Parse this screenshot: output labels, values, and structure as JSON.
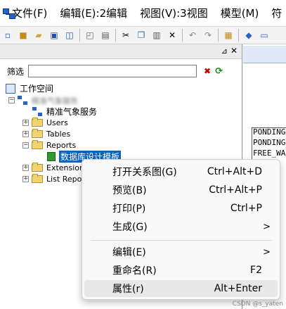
{
  "menubar": {
    "items": [
      "文件(F)",
      "编辑(E):2编辑",
      "视图(V):3视图",
      "模型(M)",
      "符"
    ]
  },
  "toolbar": {
    "icons": [
      "new-icon",
      "open-model-icon",
      "open-folder-icon",
      "save-icon",
      "save-all-icon",
      "print-preview-icon",
      "print-icon",
      "cut-icon",
      "copy-icon",
      "paste-icon",
      "delete-icon",
      "undo-icon",
      "redo-icon",
      "properties-icon",
      "help-icon",
      "window-icon"
    ]
  },
  "browser": {
    "filter_label": "筛选",
    "filter_value": "",
    "tree": {
      "workspace": "工作空间",
      "model": "精准气象服务",
      "diagram": "精准气象服务",
      "users": "Users",
      "tables": "Tables",
      "reports": "Reports",
      "report_item": "数据库设计模板",
      "extensions": "Extension",
      "list_reports": "List Repo"
    }
  },
  "right_pane": {
    "lines": [
      "PONDING",
      "PONDING",
      "FREE_WA"
    ]
  },
  "context_menu": {
    "items": [
      {
        "label": "打开关系图(G)",
        "shortcut": "Ctrl+Alt+D"
      },
      {
        "label": "预览(B)",
        "shortcut": "Ctrl+Alt+P"
      },
      {
        "label": "打印(P)",
        "shortcut": "Ctrl+P"
      },
      {
        "label": "生成(G)",
        "shortcut": "",
        "submenu": ">"
      },
      {
        "label": "编辑(E)",
        "shortcut": "",
        "submenu": ">"
      },
      {
        "label": "重命名(R)",
        "shortcut": "F2"
      },
      {
        "label": "属性(r)",
        "shortcut": "Alt+Enter"
      }
    ]
  },
  "watermark": "CSDN @s_yaten"
}
